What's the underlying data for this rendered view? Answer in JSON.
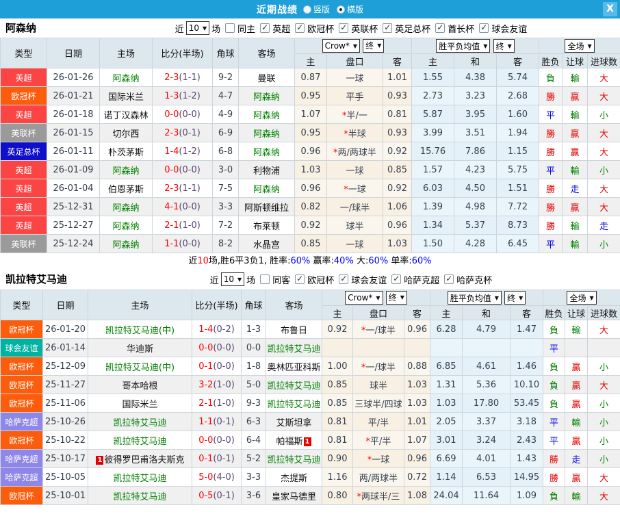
{
  "titlebar": {
    "title": "近期战绩",
    "layout_options": [
      {
        "label": "竖版",
        "checked": false
      },
      {
        "label": "横版",
        "checked": true
      }
    ],
    "close_label": "X"
  },
  "headers": {
    "type": "类型",
    "date": "日期",
    "home": "主场",
    "score": "比分(半场)",
    "corner": "角球",
    "away": "客场",
    "bookmaker": "Crow*",
    "final": "终",
    "avg": "胜平负均值",
    "final2": "终",
    "scope": "全场",
    "odds_home": "主",
    "handicap": "盘口",
    "odds_away": "客",
    "avg_home": "主",
    "avg_draw": "和",
    "avg_away": "客",
    "result": "胜负",
    "handicap_result": "让球",
    "goals": "进球数"
  },
  "status_colors": {
    "勝": "#e60000",
    "贏": "#e60000",
    "大": "#e60000",
    "平": "#0000e0",
    "走": "#0000e0",
    "負": "#008000",
    "輸": "#008000",
    "小": "#008000"
  },
  "type_colors": {
    "英超": "#fb4545",
    "欧冠杯": "#fc5d0d",
    "英联杯": "#9a9a9a",
    "英足总杯": "#0f0fca",
    "球会友谊": "#00b2a2",
    "哈萨克超": "#8e87e9"
  },
  "score_colors": {
    "fulltime": "#ff0000",
    "halftime": "#5a4673"
  },
  "sections": [
    {
      "team": "阿森纳",
      "filters": {
        "near": "近",
        "count": "10",
        "games": "场",
        "same": "同主",
        "same_checked": false,
        "competitions": [
          "英超",
          "欧冠杯",
          "英联杯",
          "英足总杯",
          "酋长杯",
          "球会友谊"
        ]
      },
      "rows": [
        {
          "type": "英超",
          "date": "26-01-26",
          "home": "阿森纳",
          "home_green": true,
          "ft": "2-3",
          "ht": "(1-1)",
          "corner": "9-2",
          "away": "曼联",
          "away_green": false,
          "oh": "0.87",
          "hcap": "一球",
          "oa": "1.01",
          "aw": "1.55",
          "ad": "4.38",
          "al": "5.74",
          "res": "負",
          "ah": "輸",
          "goal": "大"
        },
        {
          "type": "欧冠杯",
          "date": "26-01-21",
          "home": "国际米兰",
          "home_green": false,
          "ft": "1-3",
          "ht": "(1-2)",
          "corner": "4-7",
          "away": "阿森纳",
          "away_green": true,
          "oh": "0.95",
          "hcap": "平手",
          "oa": "0.93",
          "aw": "2.73",
          "ad": "3.23",
          "al": "2.68",
          "res": "勝",
          "ah": "贏",
          "goal": "大"
        },
        {
          "type": "英超",
          "date": "26-01-18",
          "home": "诺丁汉森林",
          "home_green": false,
          "ft": "0-0",
          "ht": "(0-0)",
          "corner": "4-9",
          "away": "阿森纳",
          "away_green": true,
          "oh": "1.07",
          "hcap": "*半/一",
          "oa": "0.81",
          "aw": "5.87",
          "ad": "3.95",
          "al": "1.60",
          "res": "平",
          "ah": "輸",
          "goal": "小"
        },
        {
          "type": "英联杯",
          "date": "26-01-15",
          "home": "切尔西",
          "home_green": false,
          "ft": "2-3",
          "ht": "(0-1)",
          "corner": "6-9",
          "away": "阿森纳",
          "away_green": true,
          "oh": "0.95",
          "hcap": "*半球",
          "oa": "0.93",
          "aw": "3.99",
          "ad": "3.51",
          "al": "1.94",
          "res": "勝",
          "ah": "贏",
          "goal": "大"
        },
        {
          "type": "英足总杯",
          "date": "26-01-11",
          "home": "朴茨茅斯",
          "home_green": false,
          "ft": "1-4",
          "ht": "(1-2)",
          "corner": "6-8",
          "away": "阿森纳",
          "away_green": true,
          "oh": "0.96",
          "hcap": "*两/两球半",
          "oa": "0.92",
          "aw": "15.76",
          "ad": "7.86",
          "al": "1.15",
          "res": "勝",
          "ah": "贏",
          "goal": "大"
        },
        {
          "type": "英超",
          "date": "26-01-09",
          "home": "阿森纳",
          "home_green": true,
          "ft": "0-0",
          "ht": "(0-0)",
          "corner": "3-0",
          "away": "利物浦",
          "away_green": false,
          "oh": "1.03",
          "hcap": "一球",
          "oa": "0.85",
          "aw": "1.57",
          "ad": "4.23",
          "al": "5.75",
          "res": "平",
          "ah": "輸",
          "goal": "小"
        },
        {
          "type": "英超",
          "date": "26-01-04",
          "home": "伯恩茅斯",
          "home_green": false,
          "ft": "2-3",
          "ht": "(1-1)",
          "corner": "7-5",
          "away": "阿森纳",
          "away_green": true,
          "oh": "0.96",
          "hcap": "*一球",
          "oa": "0.92",
          "aw": "6.03",
          "ad": "4.50",
          "al": "1.51",
          "res": "勝",
          "ah": "走",
          "goal": "大"
        },
        {
          "type": "英超",
          "date": "25-12-31",
          "home": "阿森纳",
          "home_green": true,
          "ft": "4-1",
          "ht": "(0-0)",
          "corner": "3-3",
          "away": "阿斯顿维拉",
          "away_green": false,
          "oh": "0.82",
          "hcap": "一/球半",
          "oa": "1.06",
          "aw": "1.39",
          "ad": "4.98",
          "al": "7.72",
          "res": "勝",
          "ah": "贏",
          "goal": "大"
        },
        {
          "type": "英超",
          "date": "25-12-27",
          "home": "阿森纳",
          "home_green": true,
          "ft": "2-1",
          "ht": "(1-0)",
          "corner": "7-2",
          "away": "布莱顿",
          "away_green": false,
          "oh": "0.92",
          "hcap": "球半",
          "oa": "0.96",
          "aw": "1.34",
          "ad": "5.37",
          "al": "8.73",
          "res": "勝",
          "ah": "輸",
          "goal": "走"
        },
        {
          "type": "英联杯",
          "date": "25-12-24",
          "home": "阿森纳",
          "home_green": true,
          "ft": "1-1",
          "ht": "(0-0)",
          "corner": "8-2",
          "away": "水晶宫",
          "away_green": false,
          "oh": "0.85",
          "hcap": "一球",
          "oa": "1.03",
          "aw": "1.50",
          "ad": "4.28",
          "al": "6.45",
          "res": "平",
          "ah": "輸",
          "goal": "小"
        }
      ],
      "summary": [
        {
          "text": "近",
          "color": "#000000"
        },
        {
          "text": "10",
          "color": "#ff0000"
        },
        {
          "text": "场,胜6平3负1, 胜率:",
          "color": "#000000"
        },
        {
          "text": "60%",
          "color": "#0000ff"
        },
        {
          "text": " 赢率:",
          "color": "#000000"
        },
        {
          "text": "40%",
          "color": "#0000ff"
        },
        {
          "text": " 大:",
          "color": "#000000"
        },
        {
          "text": "60%",
          "color": "#0000ff"
        },
        {
          "text": " 单率:",
          "color": "#000000"
        },
        {
          "text": "60%",
          "color": "#0000ff"
        }
      ]
    },
    {
      "team": "凯拉特艾马迪",
      "filters": {
        "near": "近",
        "count": "10",
        "games": "场",
        "same": "同客",
        "same_checked": false,
        "competitions": [
          "欧冠杯",
          "球会友谊",
          "哈萨克超",
          "哈萨克杯"
        ]
      },
      "rows": [
        {
          "type": "欧冠杯",
          "date": "26-01-20",
          "home": "凯拉特艾马迪(中)",
          "home_green": true,
          "ft": "1-4",
          "ht": "(0-2)",
          "corner": "1-3",
          "away": "布鲁日",
          "away_green": false,
          "oh": "0.92",
          "hcap": "*一/球半",
          "oa": "0.96",
          "aw": "6.28",
          "ad": "4.79",
          "al": "1.47",
          "res": "負",
          "ah": "輸",
          "goal": "大"
        },
        {
          "type": "球会友谊",
          "date": "26-01-14",
          "home": "华迪斯",
          "home_green": false,
          "ft": "0-0",
          "ht": "(0-0)",
          "corner": "0-0",
          "away": "凯拉特艾马迪",
          "away_green": true,
          "oh": "",
          "hcap": "",
          "oa": "",
          "aw": "",
          "ad": "",
          "al": "",
          "res": "平",
          "ah": "",
          "goal": ""
        },
        {
          "type": "欧冠杯",
          "date": "25-12-09",
          "home": "凯拉特艾马迪(中)",
          "home_green": true,
          "ft": "0-1",
          "ht": "(0-0)",
          "corner": "1-8",
          "away": "奥林匹亚科斯",
          "away_green": false,
          "oh": "1.00",
          "hcap": "*一/球半",
          "oa": "0.88",
          "aw": "6.85",
          "ad": "4.61",
          "al": "1.46",
          "res": "負",
          "ah": "贏",
          "goal": "小"
        },
        {
          "type": "欧冠杯",
          "date": "25-11-27",
          "home": "哥本哈根",
          "home_green": false,
          "ft": "3-2",
          "ht": "(1-0)",
          "corner": "5-0",
          "away": "凯拉特艾马迪",
          "away_green": true,
          "oh": "0.85",
          "hcap": "球半",
          "oa": "1.03",
          "aw": "1.31",
          "ad": "5.36",
          "al": "10.10",
          "res": "負",
          "ah": "贏",
          "goal": "大"
        },
        {
          "type": "欧冠杯",
          "date": "25-11-06",
          "home": "国际米兰",
          "home_green": false,
          "ft": "2-1",
          "ht": "(1-0)",
          "corner": "9-3",
          "away": "凯拉特艾马迪",
          "away_green": true,
          "oh": "0.85",
          "hcap": "三球半/四球",
          "oa": "1.03",
          "aw": "1.03",
          "ad": "17.80",
          "al": "53.45",
          "res": "負",
          "ah": "贏",
          "goal": "小"
        },
        {
          "type": "哈萨克超",
          "date": "25-10-26",
          "home": "凯拉特艾马迪",
          "home_green": true,
          "ft": "1-1",
          "ht": "(0-1)",
          "corner": "6-3",
          "away": "艾斯坦拿",
          "away_green": false,
          "oh": "0.81",
          "hcap": "平/半",
          "oa": "1.01",
          "aw": "2.05",
          "ad": "3.37",
          "al": "3.18",
          "res": "平",
          "ah": "輸",
          "goal": "小"
        },
        {
          "type": "欧冠杯",
          "date": "25-10-22",
          "home": "凯拉特艾马迪",
          "home_green": true,
          "ft": "0-0",
          "ht": "(0-0)",
          "corner": "6-4",
          "away": "帕福斯",
          "away_green": false,
          "away_card": "1",
          "oh": "0.81",
          "hcap": "*平/半",
          "oa": "1.07",
          "aw": "3.01",
          "ad": "3.24",
          "al": "2.43",
          "res": "平",
          "ah": "贏",
          "goal": "小"
        },
        {
          "type": "哈萨克超",
          "date": "25-10-17",
          "home": "彼得罗巴甫洛夫斯克",
          "home_green": false,
          "home_card": "1",
          "ft": "0-1",
          "ht": "(0-1)",
          "corner": "5-2",
          "away": "凯拉特艾马迪",
          "away_green": true,
          "oh": "0.90",
          "hcap": "*一球",
          "oa": "0.96",
          "aw": "6.69",
          "ad": "4.01",
          "al": "1.43",
          "res": "勝",
          "ah": "走",
          "goal": "小"
        },
        {
          "type": "哈萨克超",
          "date": "25-10-05",
          "home": "凯拉特艾马迪",
          "home_green": true,
          "ft": "5-0",
          "ht": "(4-0)",
          "corner": "3-3",
          "away": "杰提斯",
          "away_green": false,
          "oh": "1.16",
          "hcap": "两/两球半",
          "oa": "0.72",
          "aw": "1.14",
          "ad": "6.53",
          "al": "14.95",
          "res": "勝",
          "ah": "贏",
          "goal": "大"
        },
        {
          "type": "欧冠杯",
          "date": "25-10-01",
          "home": "凯拉特艾马迪",
          "home_green": true,
          "ft": "0-5",
          "ht": "(0-1)",
          "corner": "3-6",
          "away": "皇家马德里",
          "away_green": false,
          "oh": "0.80",
          "hcap": "*两球半/三",
          "oa": "1.08",
          "aw": "24.04",
          "ad": "11.64",
          "al": "1.09",
          "res": "負",
          "ah": "輸",
          "goal": "大"
        }
      ],
      "summary": []
    }
  ]
}
